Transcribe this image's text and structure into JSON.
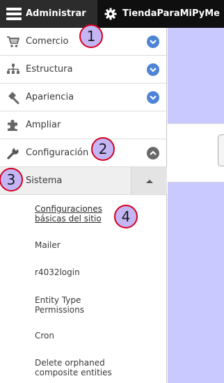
{
  "toolbar": {
    "manage_label": "Administrar",
    "site_label": "TiendaParaMiPyMe",
    "icons": {
      "menu": "hamburger-icon",
      "site": "gear-icon"
    }
  },
  "menu": {
    "items": [
      {
        "label": "Comercio",
        "icon": "cart-icon",
        "toggle": "expand"
      },
      {
        "label": "Estructura",
        "icon": "sitemap-icon",
        "toggle": "expand"
      },
      {
        "label": "Apariencia",
        "icon": "paintbrush-icon",
        "toggle": "expand"
      },
      {
        "label": "Ampliar",
        "icon": "puzzle-icon",
        "toggle": "none"
      },
      {
        "label": "Configuración",
        "icon": "wrench-icon",
        "toggle": "collapse"
      }
    ],
    "submenu": {
      "label": "Sistema",
      "items": [
        "Configuraciones básicas del sitio",
        "Mailer",
        "r4032login",
        "Entity Type Permissions",
        "Cron",
        "Delete orphaned composite entities"
      ]
    }
  },
  "annotations": [
    "1",
    "2",
    "3",
    "4"
  ],
  "colors": {
    "toolbar_bg": "#0f0f0f",
    "accent_blue": "#4d84d5",
    "annotation_border": "#d3001d",
    "annotation_fill": "#c4b5f5",
    "page_bg": "#c9c9ff"
  }
}
